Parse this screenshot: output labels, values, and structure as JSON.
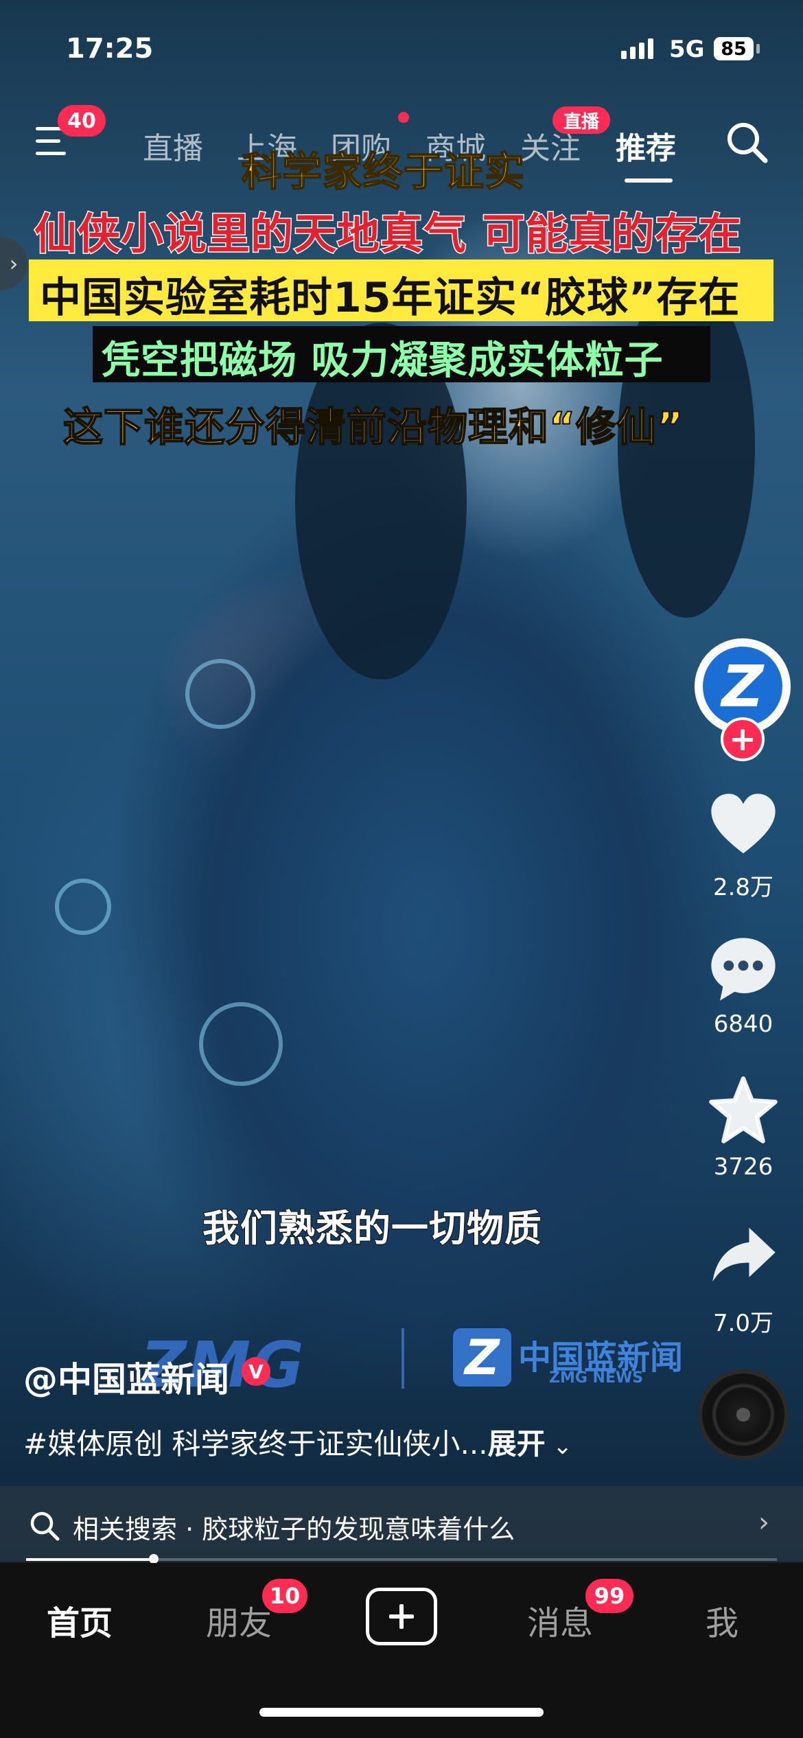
{
  "status_bar": {
    "time": "17:25",
    "network": "5G",
    "battery": "85"
  },
  "top_nav": {
    "menu_badge": "40",
    "tabs": [
      {
        "label": "直播",
        "active": false
      },
      {
        "label": "上海",
        "active": false
      },
      {
        "label": "团购",
        "active": false
      },
      {
        "label": "商城",
        "active": false
      },
      {
        "label": "关注",
        "active": false
      },
      {
        "label": "推荐",
        "active": true
      }
    ],
    "live_badge": "直播"
  },
  "video": {
    "captions": [
      "科学家终于证实",
      "仙侠小说里的天地真气 可能真的存在",
      "中国实验室耗时15年证实“胶球”存在",
      "凭空把磁场 吸力凝聚成实体粒子",
      "这下谁还分得清前沿物理和“修仙”"
    ],
    "subtitle": "我们熟悉的一切物质",
    "watermark": {
      "left": "ZMG",
      "name": "中国蓝新闻",
      "sub": "ZMG NEWS"
    }
  },
  "actions": {
    "avatar_text": "Z",
    "likes": "2.8万",
    "comments": "6840",
    "favorites": "3726",
    "shares": "7.0万"
  },
  "post": {
    "author": "@中国蓝新闻",
    "verified_mark": "V",
    "description": "#媒体原创 科学家终于证实仙侠小...",
    "expand_label": "展开"
  },
  "related_search": {
    "prefix": "相关搜索",
    "separator": "·",
    "query": "胶球粒子的发现意味着什么",
    "progress": 0.17
  },
  "tab_bar": {
    "home": "首页",
    "friends": "朋友",
    "friends_badge": "10",
    "messages": "消息",
    "messages_badge": "99",
    "me": "我"
  },
  "colors": {
    "accent": "#fe2c55",
    "caption_yellow": "#ffd83a",
    "caption_red": "#e2232f",
    "caption_green": "#8dffa8"
  }
}
